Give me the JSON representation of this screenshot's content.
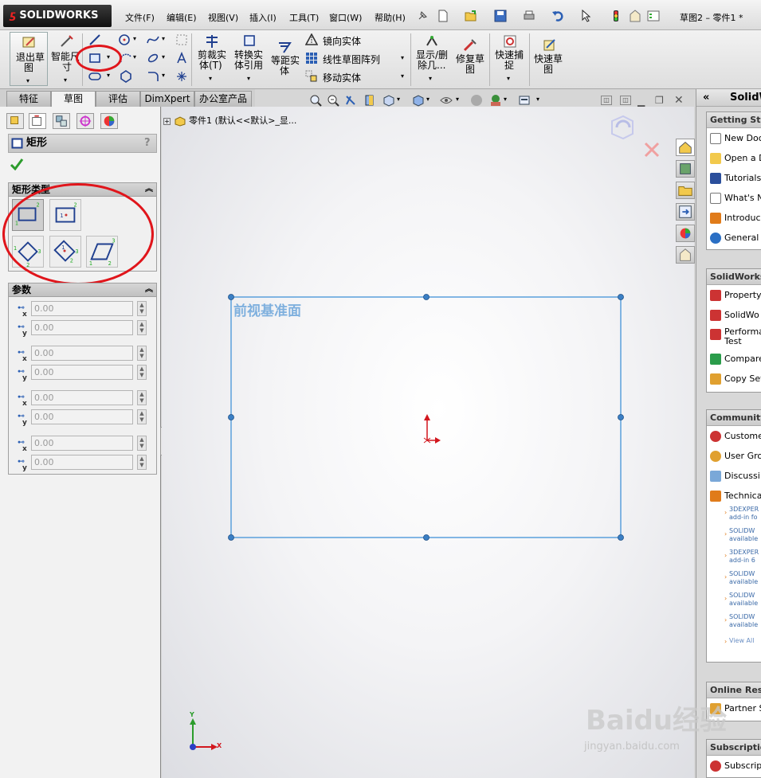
{
  "app": {
    "logo_text": "SOLIDWORKS",
    "doc_title": "草图2 – 零件1 *"
  },
  "menu": [
    "文件(F)",
    "编辑(E)",
    "视图(V)",
    "插入(I)",
    "工具(T)",
    "窗口(W)",
    "帮助(H)"
  ],
  "ribbon": {
    "exit_sketch": [
      "退出草",
      "图"
    ],
    "smart_dim": [
      "智能尺",
      "寸"
    ],
    "trim": [
      "剪裁实",
      "体(T)"
    ],
    "convert": [
      "转换实",
      "体引用"
    ],
    "offset": [
      "等距实",
      "体"
    ],
    "mirror": "镜向实体",
    "linear_pattern": "线性草图阵列",
    "move": "移动实体",
    "show_delete": [
      "显示/删",
      "除几..."
    ],
    "repair": [
      "修复草",
      "图"
    ],
    "quick_snap": [
      "快速捕",
      "捉"
    ],
    "rapid_sketch": [
      "快速草",
      "图"
    ]
  },
  "left_tabs": [
    "特征",
    "草图",
    "评估",
    "DimXpert",
    "办公室产品"
  ],
  "tree_line": "零件1 (默认<<默认>_显...",
  "property_manager": {
    "title": "矩形",
    "help": "?",
    "rect_type_header": "矩形类型",
    "params_header": "参数",
    "params": [
      {
        "x": "0.00",
        "y": "0.00"
      },
      {
        "x": "0.00",
        "y": "0.00"
      },
      {
        "x": "0.00",
        "y": "0.00"
      },
      {
        "x": "0.00",
        "y": "0.00"
      }
    ]
  },
  "graphics": {
    "plane_label": "前视基准面",
    "axis_x": "X",
    "axis_y": "Y"
  },
  "task_pane": {
    "title": "SolidW",
    "getting_started": {
      "header": "Getting Start",
      "items": [
        "New Doc",
        "Open a D",
        "Tutorials",
        "What's N",
        "Introduc",
        "General I"
      ]
    },
    "resources": {
      "header": "SolidWorks T",
      "items": [
        "Property",
        "SolidWo",
        "Performa\nTest",
        "Compare",
        "Copy Set"
      ]
    },
    "community": {
      "header": "Community",
      "items": [
        "Custome",
        "User Gro",
        "Discussi",
        "Technica"
      ],
      "news": [
        [
          "3DEXPER",
          "add-in fo"
        ],
        [
          "SOLIDW",
          "available"
        ],
        [
          "3DEXPER",
          "add-in 6"
        ],
        [
          "SOLIDW",
          "available"
        ],
        [
          "SOLIDW",
          "available"
        ],
        [
          "SOLIDW",
          "available"
        ]
      ],
      "view_all": "View All"
    },
    "online": {
      "header": "Online Reso",
      "items": [
        "Partner S"
      ]
    },
    "subscription": {
      "header": "Subscription",
      "items": [
        "Subscrip"
      ]
    }
  },
  "watermark": {
    "line1": "Baidu经验",
    "line2": "jingyan.baidu.com"
  },
  "colors": {
    "sketch_line": "#5aa0dc",
    "annotation": "#e0151b",
    "plane_label": "#7fb0de"
  }
}
